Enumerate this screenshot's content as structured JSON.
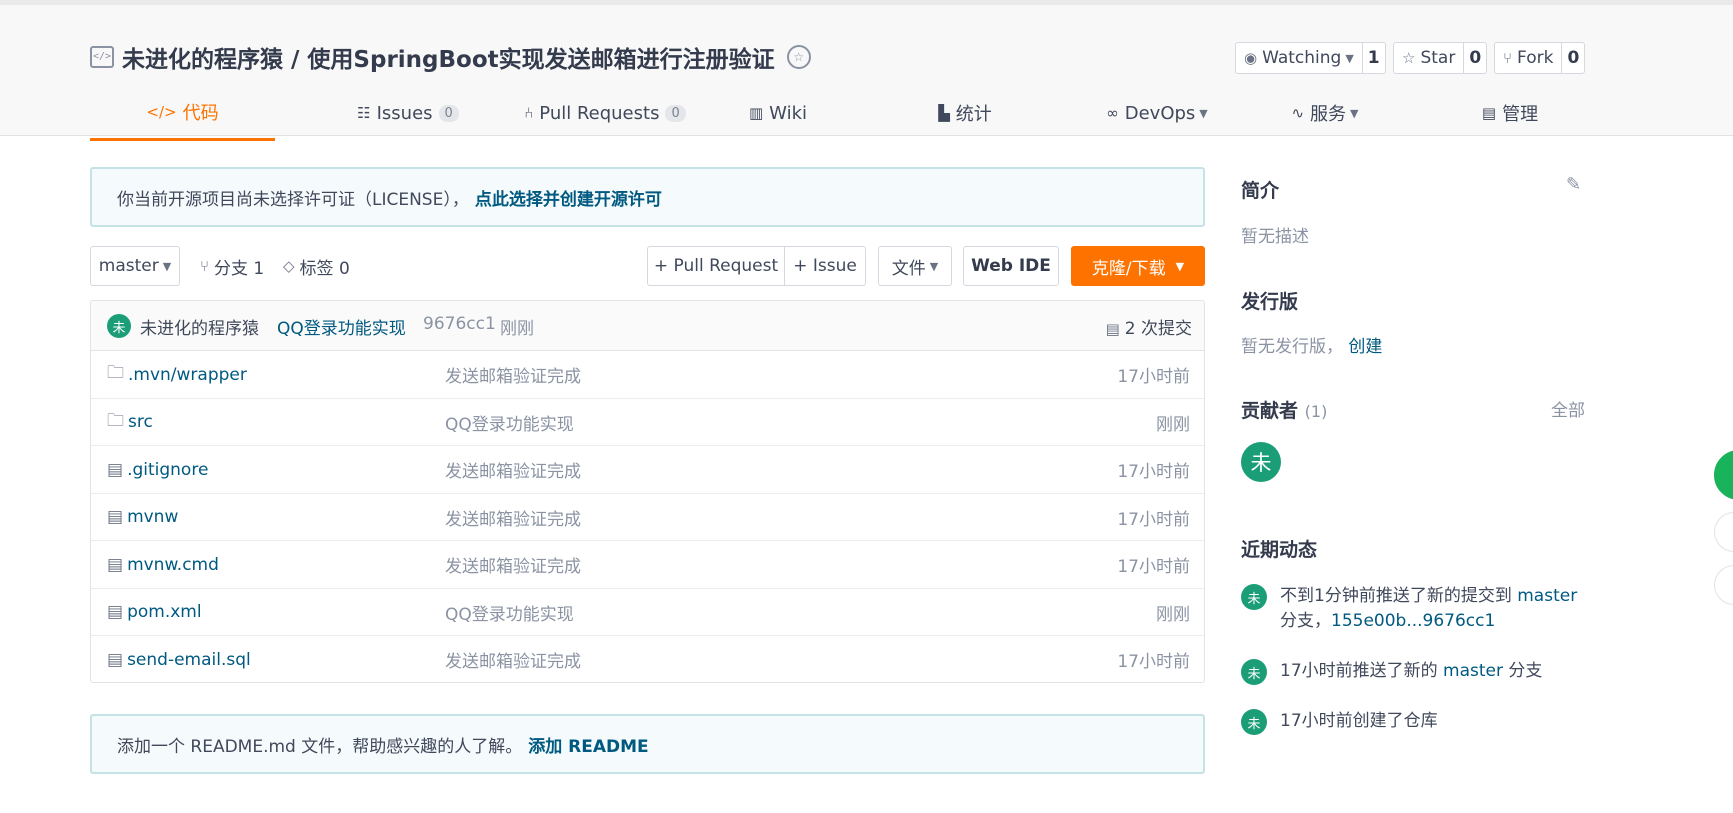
{
  "repo": {
    "title": "未进化的程序猿 / 使用SpringBoot实现发送邮箱进行注册验证",
    "icon": "code-repo-icon",
    "badge_icon": "recommend-badge-icon"
  },
  "actions": {
    "watch": {
      "label": "Watching",
      "count": "1"
    },
    "star": {
      "label": "Star",
      "count": "0"
    },
    "fork": {
      "label": "Fork",
      "count": "0"
    }
  },
  "tabs": [
    {
      "label": "代码",
      "icon": "code-icon"
    },
    {
      "label": "Issues",
      "count": "0",
      "icon": "issues-icon"
    },
    {
      "label": "Pull Requests",
      "count": "0",
      "icon": "pull-request-icon"
    },
    {
      "label": "Wiki",
      "icon": "book-icon"
    },
    {
      "label": "统计",
      "icon": "chart-icon"
    },
    {
      "label": "DevOps",
      "icon": "infinity-icon"
    },
    {
      "label": "服务",
      "icon": "pulse-icon"
    },
    {
      "label": "管理",
      "icon": "settings-doc-icon"
    }
  ],
  "license_notice": {
    "text": "你当前开源项目尚未选择许可证（LICENSE），",
    "link": "点此选择并创建开源许可"
  },
  "toolbar": {
    "branch": "master",
    "branches": "分支 1",
    "tags": "标签 0",
    "pull_request": "+ Pull Request",
    "issue": "+ Issue",
    "file": "文件",
    "web_ide": "Web IDE",
    "clone": "克隆/下载"
  },
  "last_commit": {
    "avatar": "未",
    "author": "未进化的程序猿",
    "message": "QQ登录功能实现",
    "hash": "9676cc1",
    "time": "刚刚",
    "commits": "2 次提交"
  },
  "files": [
    {
      "name": ".mvn/wrapper",
      "type": "folder",
      "message": "发送邮箱验证完成",
      "time": "17小时前"
    },
    {
      "name": "src",
      "type": "folder",
      "message": "QQ登录功能实现",
      "time": "刚刚"
    },
    {
      "name": ".gitignore",
      "type": "file",
      "message": "发送邮箱验证完成",
      "time": "17小时前"
    },
    {
      "name": "mvnw",
      "type": "file",
      "message": "发送邮箱验证完成",
      "time": "17小时前"
    },
    {
      "name": "mvnw.cmd",
      "type": "file",
      "message": "发送邮箱验证完成",
      "time": "17小时前"
    },
    {
      "name": "pom.xml",
      "type": "file",
      "message": "QQ登录功能实现",
      "time": "刚刚"
    },
    {
      "name": "send-email.sql",
      "type": "file",
      "message": "发送邮箱验证完成",
      "time": "17小时前"
    }
  ],
  "readme_notice": {
    "text": "添加一个 README.md 文件，帮助感兴趣的人了解。",
    "link": "添加 README"
  },
  "sidebar": {
    "intro_title": "简介",
    "intro_text": "暂无描述",
    "release_title": "发行版",
    "release_text": "暂无发行版，",
    "release_link": "创建",
    "contrib_title": "贡献者",
    "contrib_count": "(1)",
    "contrib_all": "全部",
    "contrib_avatar": "未",
    "activity_title": "近期动态",
    "activities": [
      {
        "avatar": "未",
        "pre": "不到1分钟前推送了新的提交到",
        "branch": "master",
        "line2_pre": "分支，",
        "range": "155e00b...9676cc1"
      },
      {
        "avatar": "未",
        "pre": "17小时前推送了新的",
        "branch": "master",
        "post": "分支"
      },
      {
        "avatar": "未",
        "text": "17小时前创建了仓库"
      }
    ]
  },
  "colors": {
    "accent": "#fe7300",
    "link": "#005980",
    "avatar": "#1b9e77"
  }
}
